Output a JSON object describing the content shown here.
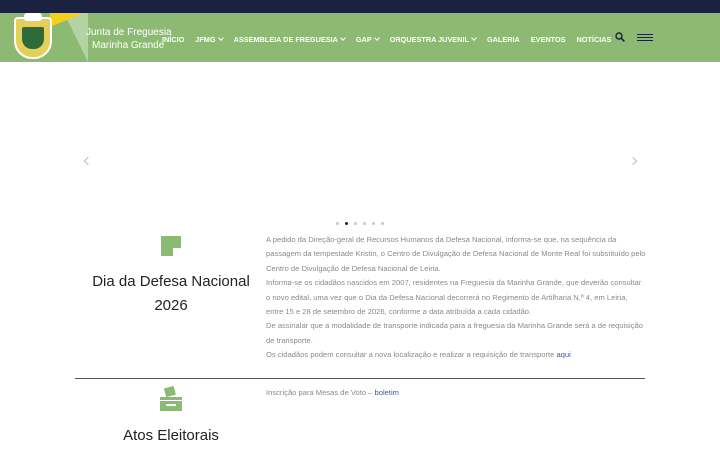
{
  "logo": {
    "line1": "Junta de Freguesia",
    "line2": "Marinha Grande"
  },
  "nav": {
    "items": [
      {
        "label": "INÍCIO",
        "has_dropdown": false
      },
      {
        "label": "JFMG",
        "has_dropdown": true
      },
      {
        "label": "ASSEMBLEIA DE FREGUESIA",
        "has_dropdown": true
      },
      {
        "label": "GAP",
        "has_dropdown": true
      },
      {
        "label": "ORQUESTRA JUVENIL",
        "has_dropdown": true
      },
      {
        "label": "GALERIA",
        "has_dropdown": false
      },
      {
        "label": "EVENTOS",
        "has_dropdown": false
      },
      {
        "label": "NOTÍCIAS",
        "has_dropdown": false
      }
    ],
    "search_icon": "search-icon",
    "menu_icon": "hamburger-icon"
  },
  "slider": {
    "dot_count": 6,
    "active_dot": 2
  },
  "news": [
    {
      "icon": "note-icon",
      "title_line1": "Dia da Defesa Nacional",
      "title_line2": "2026",
      "paragraphs": [
        "A pedido da Direção-geral de Recursos Humanos da Defesa Nacional, informa-se que, na sequência da passagem da tempestade Kristin, o Centro de Divulgação de Defesa Nacional de Monte Real foi substituído pelo Centro de Divulgação de Defesa Nacional de Leiria.",
        "Informa-se os cidadãos nascidos em 2007, residentes na Freguesia da Marinha Grande, que deverão consultar o novo edital, uma vez que o Dia da Defesa Nacional decorrerá no Regimento de Artilharia N.º 4, em Leiria, entre 15 e 28 de setembro de 2026, conforme a data atribuída a cada cidadão.",
        "De assinalar que a modalidade de transporte indicada para a freguesia da Marinha Grande será a de requisição de transporte.",
        "Os cidadãos podem consultar a nova localização e realizar a requisição de transporte"
      ],
      "link_text": "aqui"
    },
    {
      "icon": "ballot-box-icon",
      "title_line1": "Atos Eleitorais",
      "body_text": "Inscrição para Mesas de Voto –",
      "link_text": "boletim"
    }
  ],
  "colors": {
    "topbar": "#1b2140",
    "navbar": "#8dba72",
    "icon_green": "#8dba72",
    "link": "#2f5ea8"
  }
}
